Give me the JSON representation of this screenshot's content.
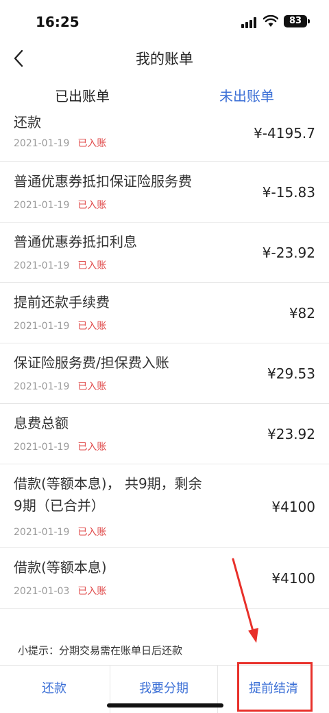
{
  "status_bar": {
    "time": "16:25",
    "battery": "83"
  },
  "nav": {
    "title": "我的账单"
  },
  "tabs": [
    {
      "label": "已出账单",
      "active": false
    },
    {
      "label": "未出账单",
      "active": true
    }
  ],
  "bills": [
    {
      "title": "还款",
      "date": "2021-01-19",
      "status": "已入账",
      "amount": "¥-4195.7"
    },
    {
      "title": "普通优惠券抵扣保证险服务费",
      "date": "2021-01-19",
      "status": "已入账",
      "amount": "¥-15.83"
    },
    {
      "title": "普通优惠券抵扣利息",
      "date": "2021-01-19",
      "status": "已入账",
      "amount": "¥-23.92"
    },
    {
      "title": "提前还款手续费",
      "date": "2021-01-19",
      "status": "已入账",
      "amount": "¥82"
    },
    {
      "title": "保证险服务费/担保费入账",
      "date": "2021-01-19",
      "status": "已入账",
      "amount": "¥29.53"
    },
    {
      "title": "息费总额",
      "date": "2021-01-19",
      "status": "已入账",
      "amount": "¥23.92"
    },
    {
      "title_line1": "借款(等额本息)， 共9期，剩余",
      "title_line2": "9期（已合并）",
      "date": "2021-01-19",
      "status": "已入账",
      "amount": "¥4100"
    },
    {
      "title": "借款(等额本息)",
      "date": "2021-01-03",
      "status": "已入账",
      "amount": "¥4100"
    }
  ],
  "tip": "小提示：分期交易需在账单日后还款",
  "bottom": {
    "repay": "还款",
    "installment": "我要分期",
    "settle": "提前结清"
  },
  "colors": {
    "accent": "#3b6fd6",
    "status_red": "#e04a4a",
    "annotation_red": "#e8302a"
  }
}
